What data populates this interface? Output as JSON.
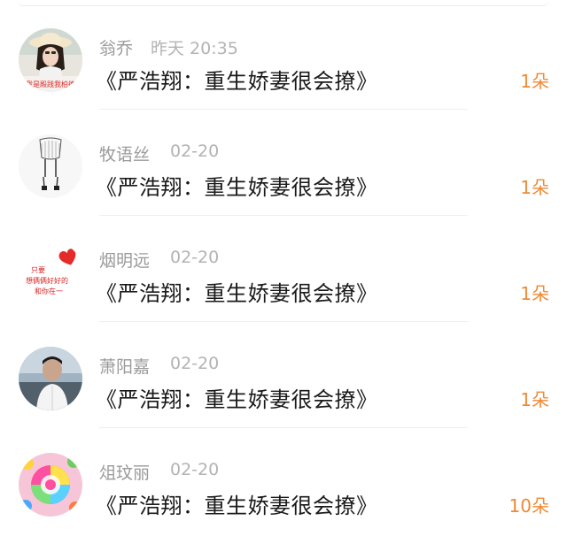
{
  "gifts": [
    {
      "name": "翁乔",
      "time": "昨天 20:35",
      "book": "《严浩翔：重生娇妻很会撩》",
      "count": "1朵",
      "avatar": "girl-hat-avatar",
      "avatar_caption": "我是殿践我柏德"
    },
    {
      "name": "牧语丝",
      "time": "02-20",
      "book": "《严浩翔：重生娇妻很会撩》",
      "count": "1朵",
      "avatar": "sketch-figure-avatar"
    },
    {
      "name": "烟明远",
      "time": "02-20",
      "book": "《严浩翔：重生娇妻很会撩》",
      "count": "1朵",
      "avatar": "heart-text-avatar",
      "avatar_caption_lines": [
        "只要",
        "想俩俩好好的",
        "和你在一"
      ]
    },
    {
      "name": "萧阳嘉",
      "time": "02-20",
      "book": "《严浩翔：重生娇妻很会撩》",
      "count": "1朵",
      "avatar": "man-photo-avatar"
    },
    {
      "name": "俎玟丽",
      "time": "02-20",
      "book": "《严浩翔：重生娇妻很会撩》",
      "count": "10朵",
      "avatar": "lollipop-avatar"
    }
  ],
  "colors": {
    "name": "#9a9a9a",
    "time": "#b3b3b3",
    "book": "#1a1a1a",
    "count": "#ef8a35",
    "divider": "#efefef"
  }
}
